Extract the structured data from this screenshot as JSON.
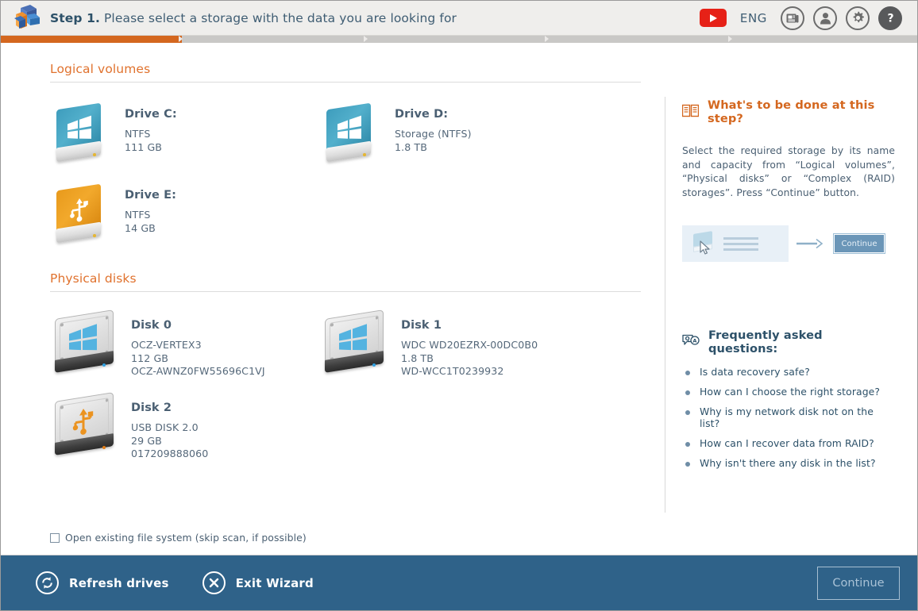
{
  "header": {
    "step_number": "Step 1.",
    "step_text": "Please select a storage with the data you are looking for",
    "language": "ENG",
    "logo_name": "app-logo",
    "youtube_label": "",
    "icons": {
      "news": "news-icon",
      "account": "user-icon",
      "settings": "gear-icon",
      "help": "help-icon"
    }
  },
  "progress": {
    "segments": 5,
    "current": 1
  },
  "sections": {
    "logical_volumes_title": "Logical volumes",
    "physical_disks_title": "Physical disks"
  },
  "logical_volumes": [
    {
      "name": "Drive C:",
      "fs": "NTFS",
      "size": "111 GB",
      "extra": "",
      "icon": "windows-volume-icon"
    },
    {
      "name": "Drive D:",
      "fs": "Storage (NTFS)",
      "size": "1.8 TB",
      "extra": "",
      "icon": "windows-volume-icon"
    },
    {
      "name": "Drive E:",
      "fs": "NTFS",
      "size": "14 GB",
      "extra": "",
      "icon": "usb-volume-icon"
    }
  ],
  "physical_disks": [
    {
      "name": "Disk 0",
      "model": "OCZ-VERTEX3",
      "size": "112 GB",
      "serial": "OCZ-AWNZ0FW55696C1VJ",
      "icon": "windows-hdd-icon"
    },
    {
      "name": "Disk 1",
      "model": "WDC WD20EZRX-00DC0B0",
      "size": "1.8 TB",
      "serial": "WD-WCC1T0239932",
      "icon": "windows-hdd-icon"
    },
    {
      "name": "Disk 2",
      "model": "USB DISK 2.0",
      "size": "29 GB",
      "serial": "017209888060",
      "icon": "usb-hdd-icon"
    }
  ],
  "checkbox": {
    "label": "Open existing file system (skip scan, if possible)",
    "checked": false
  },
  "sidebar": {
    "help_title": "What's to be done at this step?",
    "help_text": "Select the required storage by its name and capacity from “Logical volumes”, “Physical disks” or “Complex (RAID) storages”. Press “Continue” button.",
    "illustration_button_label": "Continue",
    "faq_title": "Frequently asked questions:",
    "faq_items": [
      "Is data recovery safe?",
      "How can I choose the right storage?",
      "Why is my network disk not on the list?",
      "How can I recover data from RAID?",
      "Why isn't there any disk in the list?"
    ]
  },
  "footer": {
    "refresh_label": "Refresh drives",
    "exit_label": "Exit Wizard",
    "continue_label": "Continue"
  },
  "colors": {
    "accent_orange": "#d4671f",
    "header_bg": "#efeeec",
    "footer_bg": "#2f6289",
    "text_blue": "#4a5f72",
    "youtube_red": "#e62117"
  }
}
